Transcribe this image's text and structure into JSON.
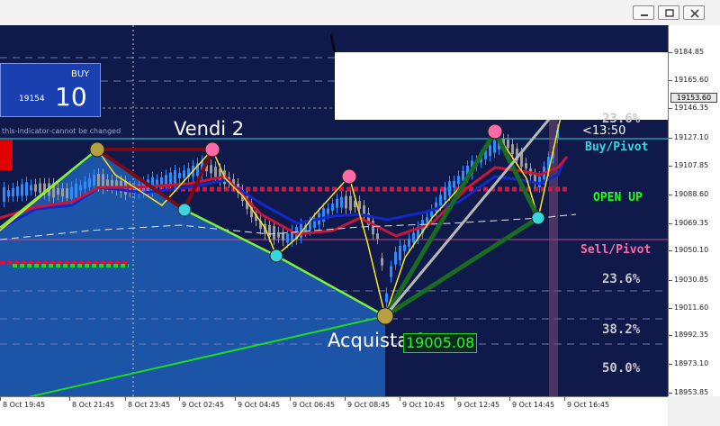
{
  "trade_panel": {
    "buy_label": "BUY",
    "bid_small": "19154",
    "bid_big": "10"
  },
  "indicator_notice": "this-indicator-cannot be changed",
  "annotations": {
    "vendi": "Vendi 2",
    "acquista": "Acquista 1",
    "price_tag": "19005.08",
    "timer": "<13:50"
  },
  "levels": {
    "fib_236_top": "23.6%",
    "buy_pivot": "Buy/Pivot",
    "open_up": "OPEN UP",
    "sell_pivot": "Sell/Pivot",
    "fib_236_low": "23.6%",
    "fib_382": "38.2%",
    "fib_500": "50.0%"
  },
  "price_axis": [
    "9184.85",
    "19165.60",
    "19146.35",
    "19127.10",
    "19107.85",
    "19088.60",
    "19069.35",
    "19050.10",
    "19030.85",
    "19011.60",
    "18992.35",
    "18973.10",
    "18953.85"
  ],
  "current_price": "19153.60",
  "time_axis": [
    "8 Oct 19:45",
    "8 Oct 21:45",
    "8 Oct 23:45",
    "9 Oct 02:45",
    "9 Oct 04:45",
    "9 Oct 06:45",
    "9 Oct 08:45",
    "9 Oct 10:45",
    "9 Oct 12:45",
    "9 Oct 14:45",
    "9 Oct 16:45"
  ],
  "colors": {
    "chart_bg": "#0f1a4a",
    "bull": "#2f8cff",
    "bear": "#9a9a9a",
    "fib_text": "#c8c8c8",
    "buy_pivot": "#3ad6e0",
    "open_up": "#1bff1b",
    "sell_pivot": "#ff6aa8"
  }
}
